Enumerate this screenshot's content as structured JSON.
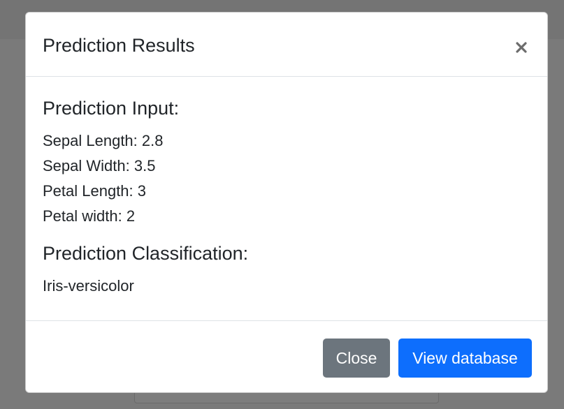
{
  "modal": {
    "title": "Prediction Results",
    "close_icon": "close-icon"
  },
  "body": {
    "input_heading": "Prediction Input:",
    "inputs": [
      "Sepal Length: 2.8",
      "Sepal Width: 3.5",
      "Petal Length: 3",
      "Petal width: 2"
    ],
    "classification_heading": "Prediction Classification:",
    "classification_value": "Iris-versicolor"
  },
  "footer": {
    "close_label": "Close",
    "view_database_label": "View database"
  },
  "colors": {
    "primary": "#0d6efd",
    "secondary": "#6c757d",
    "backdrop": "#7a7a7a"
  }
}
